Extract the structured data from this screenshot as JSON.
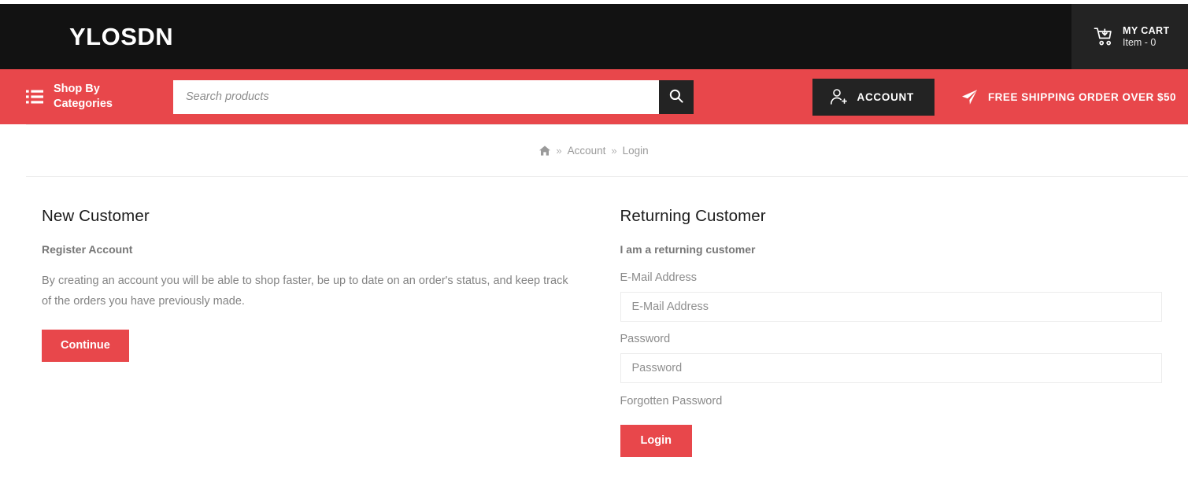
{
  "header": {
    "logo": "YLOSDN",
    "cart": {
      "icon": "cart-download-icon",
      "title": "MY CART",
      "count_label": "Item - 0"
    }
  },
  "nav": {
    "shop_by": {
      "icon": "list-menu-icon",
      "line1": "Shop By",
      "line2": "Categories"
    },
    "search": {
      "placeholder": "Search products",
      "value": "",
      "button_icon": "search-icon"
    },
    "account": {
      "icon": "user-plus-icon",
      "label": "ACCOUNT"
    },
    "shipping": {
      "icon": "paper-plane-icon",
      "label": "FREE SHIPPING ORDER OVER $50"
    }
  },
  "breadcrumb": {
    "home_icon": "home-icon",
    "separator": "»",
    "items": [
      {
        "label": "Account"
      },
      {
        "label": "Login"
      }
    ]
  },
  "main": {
    "new_customer": {
      "title": "New Customer",
      "subtitle": "Register Account",
      "description": "By creating an account you will be able to shop faster, be up to date on an order's status, and keep track of the orders you have previously made.",
      "continue_label": "Continue"
    },
    "returning_customer": {
      "title": "Returning Customer",
      "subtitle": "I am a returning customer",
      "email_label": "E-Mail Address",
      "email_placeholder": "E-Mail Address",
      "email_value": "",
      "password_label": "Password",
      "password_placeholder": "Password",
      "password_value": "",
      "forgot_label": "Forgotten Password",
      "login_label": "Login"
    }
  },
  "colors": {
    "accent_red": "#e8474b",
    "header_dark": "#121212",
    "button_dark": "#232323",
    "text_muted": "#8b8b8b",
    "border": "#ececec"
  }
}
